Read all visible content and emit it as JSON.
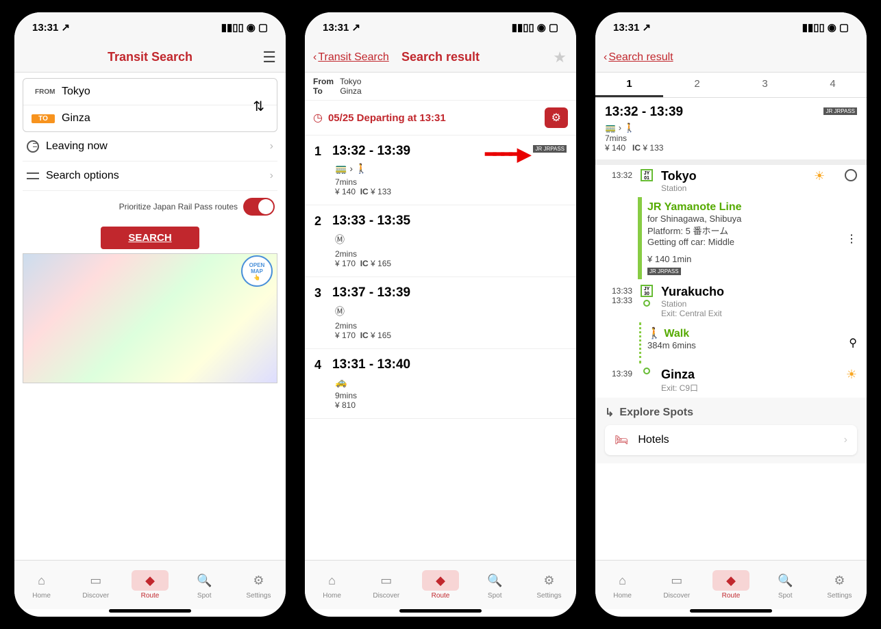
{
  "status": {
    "time": "13:31",
    "loc_arrow": "↗"
  },
  "screen1": {
    "title": "Transit Search",
    "from_label": "FROM",
    "to_label": "TO",
    "from": "Tokyo",
    "to": "Ginza",
    "leaving": "Leaving now",
    "options": "Search options",
    "prioritize": "Prioritize Japan Rail Pass routes",
    "search": "SEARCH",
    "open_map": "OPEN MAP"
  },
  "screen2": {
    "back": "Transit Search",
    "title": "Search result",
    "from_label": "From",
    "to_label": "To",
    "from": "Tokyo",
    "to": "Ginza",
    "departing": "05/25 Departing at 13:31",
    "results": [
      {
        "n": "1",
        "time": "13:32 - 13:39",
        "dur": "7mins",
        "fare": "¥ 140",
        "ic_lbl": "IC",
        "ic": "¥ 133",
        "jr": "JR JRPASS",
        "modes": "🚃 › 🚶"
      },
      {
        "n": "2",
        "time": "13:33 - 13:35",
        "dur": "2mins",
        "fare": "¥ 170",
        "ic_lbl": "IC",
        "ic": "¥ 165",
        "modes": "Ⓜ"
      },
      {
        "n": "3",
        "time": "13:37 - 13:39",
        "dur": "2mins",
        "fare": "¥ 170",
        "ic_lbl": "IC",
        "ic": "¥ 165",
        "modes": "Ⓜ"
      },
      {
        "n": "4",
        "time": "13:31 - 13:40",
        "dur": "9mins",
        "fare": "¥ 810",
        "modes": "🚕"
      }
    ]
  },
  "screen3": {
    "back": "Search result",
    "tabs": [
      "1",
      "2",
      "3",
      "4"
    ],
    "summary_time": "13:32 - 13:39",
    "summary_modes": "🚃 › 🚶",
    "summary_dur": "7mins",
    "summary_fare": "¥ 140",
    "summary_ic_lbl": "IC",
    "summary_ic": "¥ 133",
    "jr": "JR JRPASS",
    "s1_time": "13:32",
    "s1_code": "JY 01",
    "s1_name": "Tokyo",
    "s1_sub": "Station",
    "line_name": "JR Yamanote Line",
    "line_for": "for Shinagawa, Shibuya",
    "line_platform": "Platform:  5 番ホーム",
    "line_car": "Getting off car: Middle",
    "line_fare": "¥ 140 1min",
    "s2_time1": "13:33",
    "s2_time2": "13:33",
    "s2_code": "JY 30",
    "s2_name": "Yurakucho",
    "s2_sub": "Station",
    "s2_exit": "Exit: Central Exit",
    "walk_lbl": "Walk",
    "walk_detail": "384m  6mins",
    "s3_time": "13:39",
    "s3_name": "Ginza",
    "s3_exit": "Exit: C9口",
    "explore": "Explore Spots",
    "hotels": "Hotels"
  },
  "tabs": {
    "home": "Home",
    "discover": "Discover",
    "route": "Route",
    "spot": "Spot",
    "settings": "Settings"
  }
}
